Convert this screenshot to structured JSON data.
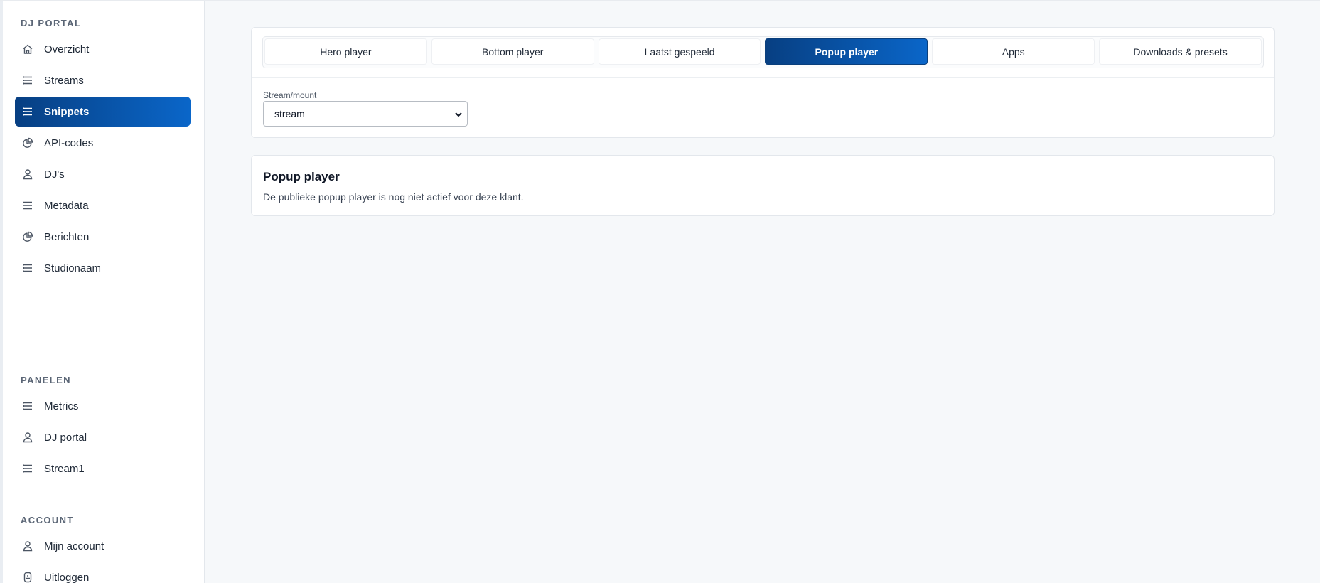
{
  "sidebar": {
    "sections": [
      {
        "title": "DJ PORTAL",
        "items": [
          {
            "label": "Overzicht",
            "icon": "home-icon"
          },
          {
            "label": "Streams",
            "icon": "list-icon"
          },
          {
            "label": "Snippets",
            "icon": "list-icon",
            "active": true
          },
          {
            "label": "API-codes",
            "icon": "pie-chart-icon"
          },
          {
            "label": "DJ's",
            "icon": "user-icon"
          },
          {
            "label": "Metadata",
            "icon": "list-icon"
          },
          {
            "label": "Berichten",
            "icon": "pie-chart-icon"
          },
          {
            "label": "Studionaam",
            "icon": "list-icon"
          }
        ]
      },
      {
        "title": "PANELEN",
        "items": [
          {
            "label": "Metrics",
            "icon": "list-icon"
          },
          {
            "label": "DJ portal",
            "icon": "user-icon"
          },
          {
            "label": "Stream1",
            "icon": "list-icon"
          }
        ]
      },
      {
        "title": "ACCOUNT",
        "items": [
          {
            "label": "Mijn account",
            "icon": "user-icon"
          },
          {
            "label": "Uitloggen",
            "icon": "logout-icon"
          }
        ]
      }
    ]
  },
  "tabs": [
    {
      "label": "Hero player"
    },
    {
      "label": "Bottom player"
    },
    {
      "label": "Laatst gespeeld"
    },
    {
      "label": "Popup player",
      "active": true
    },
    {
      "label": "Apps"
    },
    {
      "label": "Downloads & presets"
    }
  ],
  "stream_select": {
    "label": "Stream/mount",
    "value": "stream"
  },
  "info_card": {
    "title": "Popup player",
    "text": "De publieke popup player is nog niet actief voor deze klant."
  },
  "colors": {
    "accent_start": "#073f82",
    "accent_end": "#0a66c9",
    "background": "#f6f8fa"
  }
}
